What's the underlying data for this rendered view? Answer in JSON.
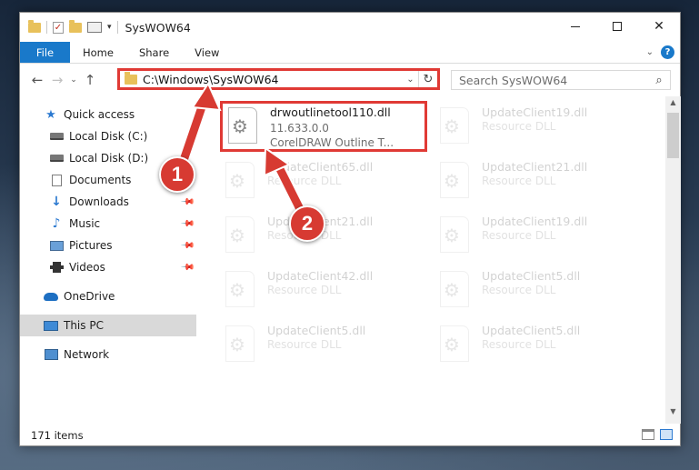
{
  "window": {
    "title": "SysWOW64",
    "minimize_glyph": "",
    "close_glyph": "✕"
  },
  "ribbon": {
    "file_tab": "File",
    "tabs": [
      "Home",
      "Share",
      "View"
    ],
    "help_glyph": "?"
  },
  "navbar": {
    "back_glyph": "←",
    "forward_glyph": "→",
    "recent_glyph": "⌄",
    "up_glyph": "↑",
    "address": "C:\\Windows\\SysWOW64",
    "refresh_glyph": "↻",
    "search_placeholder": "Search SysWOW64",
    "search_glyph": "⌕"
  },
  "sidebar": {
    "items": [
      {
        "label": "Quick access",
        "icon": "star-icon",
        "pinned": false
      },
      {
        "label": "Local Disk (C:)",
        "icon": "disk-icon",
        "pinned": false
      },
      {
        "label": "Local Disk (D:)",
        "icon": "disk-icon",
        "pinned": false
      },
      {
        "label": "Documents",
        "icon": "document-icon",
        "pinned": true
      },
      {
        "label": "Downloads",
        "icon": "download-icon",
        "pinned": true
      },
      {
        "label": "Music",
        "icon": "music-icon",
        "pinned": true
      },
      {
        "label": "Pictures",
        "icon": "pictures-icon",
        "pinned": true
      },
      {
        "label": "Videos",
        "icon": "video-icon",
        "pinned": true
      },
      {
        "label": "OneDrive",
        "icon": "cloud-icon",
        "pinned": false
      },
      {
        "label": "This PC",
        "icon": "computer-icon",
        "pinned": false,
        "selected": true
      },
      {
        "label": "Network",
        "icon": "network-icon",
        "pinned": false
      }
    ]
  },
  "files": [
    {
      "name": "drwoutlinetool110.dll",
      "line1": "11.633.0.0",
      "line2": "CorelDRAW Outline T...",
      "highlighted": true
    },
    {
      "name": "UpdateClient19.dll",
      "line1": "Resource DLL"
    },
    {
      "name": "UpdateClient65.dll",
      "line1": "Resource DLL"
    },
    {
      "name": "UpdateClient21.dll",
      "line1": "Resource DLL"
    },
    {
      "name": "UpdateClient21.dll",
      "line1": "Resource DLL"
    },
    {
      "name": "UpdateClient19.dll",
      "line1": "Resource DLL"
    },
    {
      "name": "UpdateClient42.dll",
      "line1": "Resource DLL"
    },
    {
      "name": "UpdateClient5.dll",
      "line1": "Resource DLL"
    },
    {
      "name": "UpdateClient5.dll",
      "line1": "Resource DLL"
    },
    {
      "name": "UpdateClient5.dll",
      "line1": "Resource DLL"
    }
  ],
  "status": {
    "item_count": "171 items"
  },
  "annotations": {
    "step1": "1",
    "step2": "2"
  },
  "colors": {
    "accent": "#1979ca",
    "highlight_red": "#e03a35",
    "badge_red": "#d73a32"
  }
}
